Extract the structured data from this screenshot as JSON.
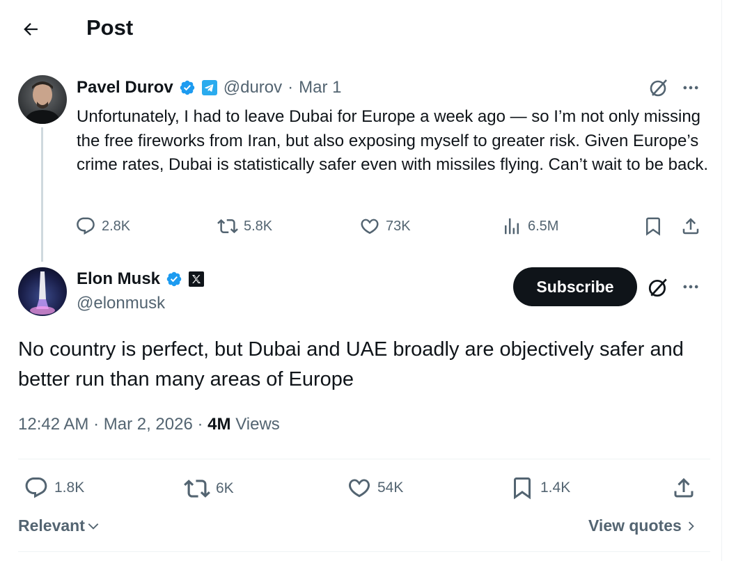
{
  "header": {
    "title": "Post"
  },
  "parent_post": {
    "author_name": "Pavel Durov",
    "handle": "@durov",
    "separator": "·",
    "date": "Mar 1",
    "text": "Unfortunately, I had to leave Dubai for Europe a week ago — so I’m not only missing the free fireworks from Iran, but also exposing myself to greater risk. Given Europe’s crime rates, Dubai is statistically safer even with missiles flying. Can’t wait to be back.",
    "replies": "2.8K",
    "reposts": "5.8K",
    "likes": "73K",
    "views": "6.5M"
  },
  "main_post": {
    "author_name": "Elon Musk",
    "handle": "@elonmusk",
    "subscribe_label": "Subscribe",
    "text": "No country is perfect, but Dubai and UAE broadly are objectively safer and better run than many areas of Europe",
    "time": "12:42 AM",
    "dot": "·",
    "date": "Mar 2, 2026",
    "views_count": "4M",
    "views_label": "Views",
    "replies": "1.8K",
    "reposts": "6K",
    "likes": "54K",
    "bookmarks": "1.4K"
  },
  "footer": {
    "sort_label": "Relevant",
    "view_quotes_label": "View quotes"
  },
  "colors": {
    "verified": "#1d9bf0",
    "telegram": "#2aabee",
    "muted": "#536471",
    "text": "#0f1419"
  }
}
